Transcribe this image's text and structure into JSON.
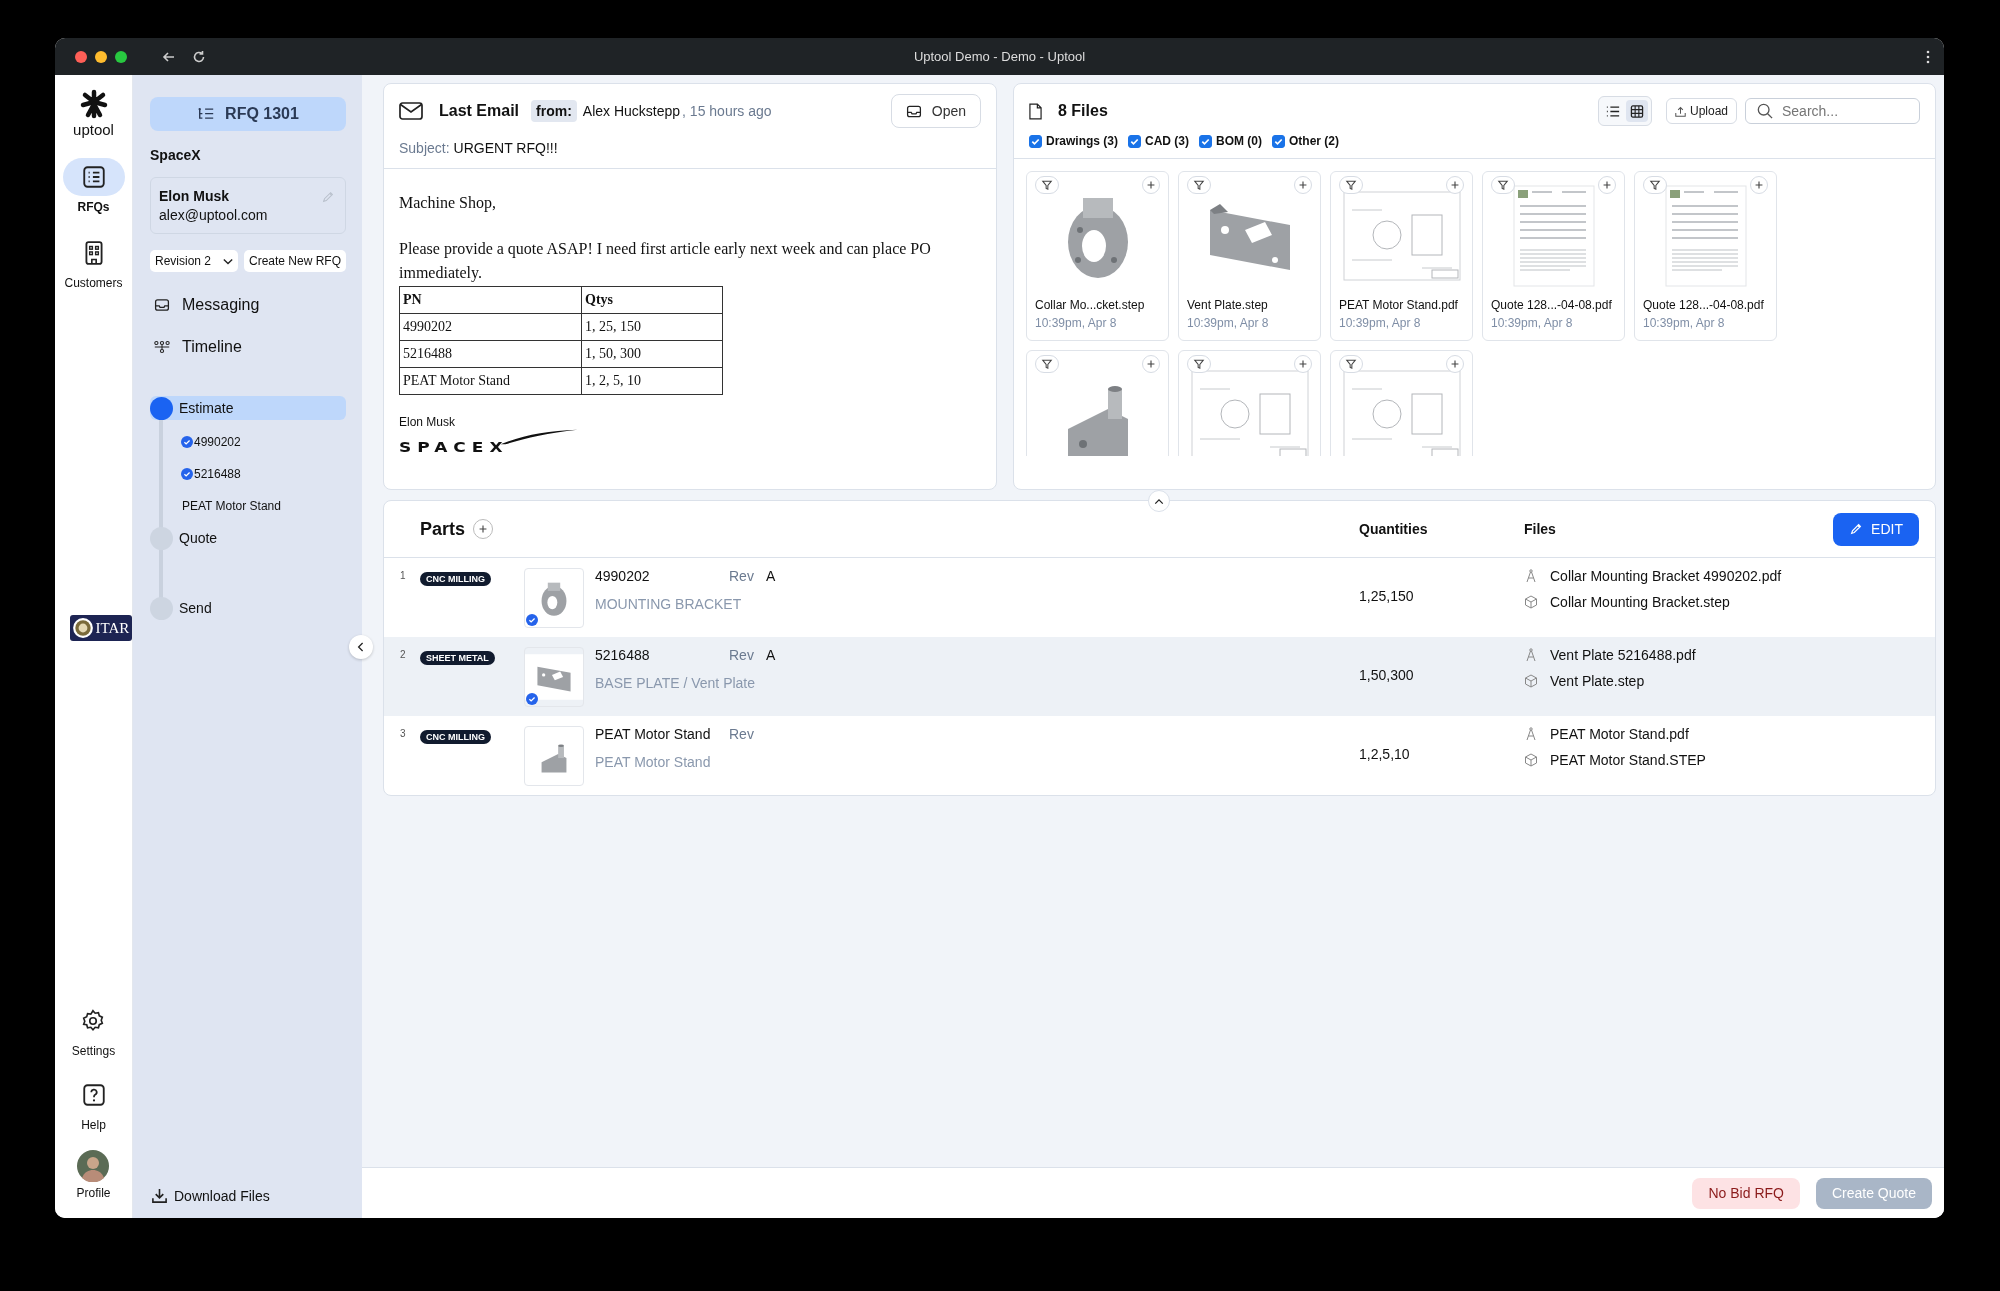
{
  "window": {
    "title": "Uptool Demo - Demo - Uptool"
  },
  "nav": {
    "logo": "uptool",
    "items": [
      {
        "label": "RFQs",
        "selected": true
      },
      {
        "label": "Customers",
        "selected": false
      }
    ],
    "badge": "ITAR",
    "bottom": [
      {
        "label": "Settings"
      },
      {
        "label": "Help"
      },
      {
        "label": "Profile"
      }
    ]
  },
  "sidebar": {
    "rfq": "RFQ 1301",
    "company": "SpaceX",
    "contact": {
      "name": "Elon Musk",
      "email": "alex@uptool.com"
    },
    "revision": "Revision 2",
    "new_rfq": "Create New RFQ",
    "links": [
      "Messaging",
      "Timeline"
    ],
    "steps": [
      {
        "label": "Estimate",
        "selected": true,
        "children": [
          {
            "label": "4990202",
            "checked": true
          },
          {
            "label": "5216488",
            "checked": true
          },
          {
            "label": "PEAT Motor Stand",
            "checked": false
          }
        ]
      },
      {
        "label": "Quote",
        "selected": false
      },
      {
        "label": "Send",
        "selected": false
      }
    ],
    "download": "Download Files"
  },
  "email": {
    "title": "Last Email",
    "from_label": "from:",
    "from": "Alex Huckstepp",
    "time": ", 15 hours ago",
    "open": "Open",
    "subject_label": "Subject:",
    "subject": "URGENT RFQ!!!",
    "greeting": "Machine Shop,",
    "body": "Please provide a quote ASAP! I need first article early next week and can place PO immediately.",
    "table": {
      "columns": [
        "PN",
        "Qtys"
      ],
      "rows": [
        [
          "4990202",
          "1, 25, 150"
        ],
        [
          "5216488",
          "1, 50, 300"
        ],
        [
          "PEAT Motor Stand",
          "1, 2, 5, 10"
        ]
      ]
    },
    "signature": "Elon Musk",
    "logo": "SPACEX"
  },
  "files": {
    "title": "8 Files",
    "views": [
      {
        "kind": "list",
        "selected": false
      },
      {
        "kind": "grid",
        "selected": true
      }
    ],
    "upload": "Upload",
    "search_placeholder": "Search...",
    "filters": [
      {
        "label": "Drawings (3)",
        "checked": true
      },
      {
        "label": "CAD (3)",
        "checked": true
      },
      {
        "label": "BOM (0)",
        "checked": true
      },
      {
        "label": "Other (2)",
        "checked": true
      }
    ],
    "items": [
      {
        "kind": "card",
        "name": "Collar Mo...cket.step",
        "time": "10:39pm, Apr 8"
      },
      {
        "kind": "card",
        "name": "Vent Plate.step",
        "time": "10:39pm, Apr 8"
      },
      {
        "kind": "card",
        "name": "PEAT Motor Stand.pdf",
        "time": "10:39pm, Apr 8"
      },
      {
        "kind": "card",
        "name": "Quote 128...-04-08.pdf",
        "time": "10:39pm, Apr 8"
      },
      {
        "kind": "card",
        "name": "Quote 128...-04-08.pdf",
        "time": "10:39pm, Apr 8"
      },
      {
        "kind": "cut"
      },
      {
        "kind": "cut"
      },
      {
        "kind": "cut"
      }
    ]
  },
  "parts": {
    "title": "Parts",
    "columns": [
      "Quantities",
      "Files"
    ],
    "edit": "EDIT",
    "rows": [
      {
        "number": "1",
        "process": "CNC MILLING",
        "pn": "4990202",
        "rev_label": "Rev",
        "rev": "A",
        "description": "MOUNTING BRACKET",
        "checked": true,
        "selected": false,
        "quantities": "1,25,150",
        "files": [
          {
            "kind": "drawing",
            "name": "Collar Mounting Bracket 4990202.pdf"
          },
          {
            "kind": "model",
            "name": "Collar Mounting Bracket.step"
          }
        ]
      },
      {
        "number": "2",
        "process": "SHEET METAL",
        "pn": "5216488",
        "rev_label": "Rev",
        "rev": "A",
        "description": "BASE PLATE / Vent Plate",
        "checked": true,
        "selected": true,
        "quantities": "1,50,300",
        "files": [
          {
            "kind": "drawing",
            "name": "Vent Plate 5216488.pdf"
          },
          {
            "kind": "model",
            "name": "Vent Plate.step"
          }
        ]
      },
      {
        "number": "3",
        "process": "CNC MILLING",
        "pn": "PEAT Motor Stand",
        "rev_label": "Rev",
        "description": "PEAT Motor Stand",
        "checked": false,
        "selected": false,
        "quantities": "1,2,5,10",
        "files": [
          {
            "kind": "drawing",
            "name": "PEAT Motor Stand.pdf"
          },
          {
            "kind": "model",
            "name": "PEAT Motor Stand.STEP"
          }
        ]
      }
    ]
  },
  "footer": {
    "no_bid": "No Bid RFQ",
    "create": "Create Quote",
    "create_disabled": true
  }
}
